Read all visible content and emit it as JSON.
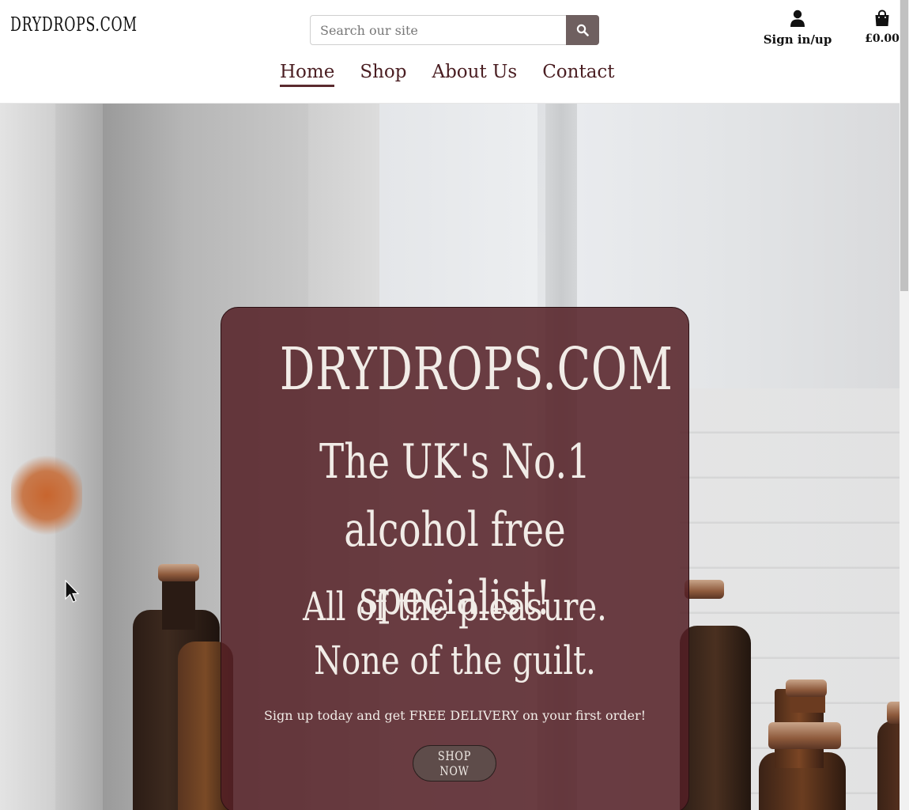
{
  "header": {
    "logo": "DRYDROPS.COM",
    "search": {
      "placeholder": "Search our site",
      "value": "",
      "button_icon": "search-icon"
    },
    "account": {
      "icon": "user-icon",
      "label": "Sign in/up"
    },
    "bag": {
      "icon": "shopping-bag-icon",
      "total": "£0.00"
    }
  },
  "nav": {
    "items": [
      {
        "label": "Home",
        "active": true
      },
      {
        "label": "Shop",
        "active": false
      },
      {
        "label": "About Us",
        "active": false
      },
      {
        "label": "Contact",
        "active": false
      }
    ]
  },
  "hero": {
    "title": "DRYDROPS.COM",
    "tagline": "The UK's No.1 alcohol free specialist!",
    "subtitle": "All of the pleasure. None of the guilt.",
    "promo": "Sign up today and get FREE DELIVERY on your first order!",
    "cta": "SHOP NOW",
    "overlay_color": "#541f25"
  },
  "colors": {
    "brand": "#4a1e22",
    "search_button": "#6f6060",
    "cta_button": "#5e4c4a"
  }
}
